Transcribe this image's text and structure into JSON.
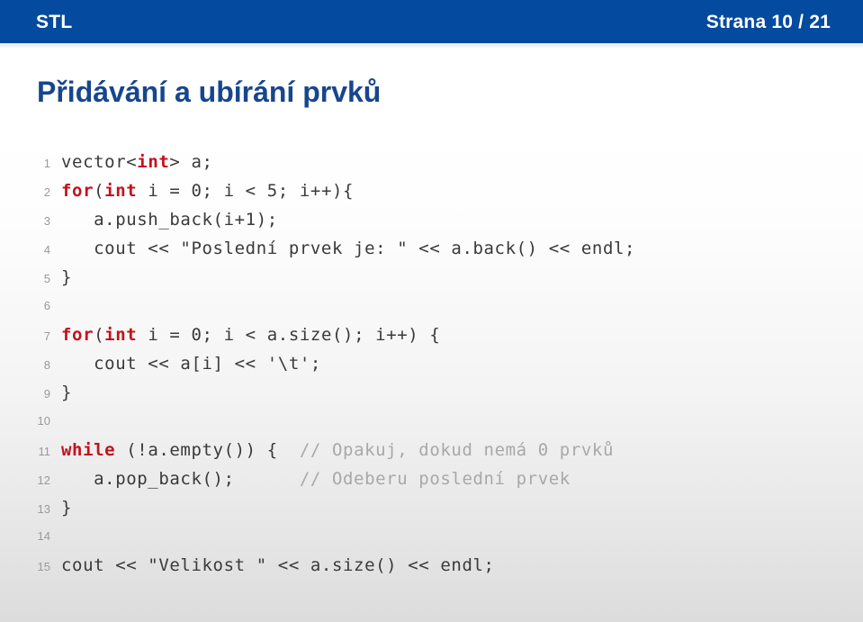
{
  "header": {
    "title": "STL",
    "page_label": "Strana 10 / 21",
    "bar_color": "#044a9e",
    "text_color": "#ffffff"
  },
  "slide": {
    "title": "Přidávání a ubírání prvků",
    "title_color": "#17468f"
  },
  "code": {
    "language": "C++",
    "keyword_color": "#c1121c",
    "comment_color": "#a8a8a8",
    "text_color": "#3a3a3a",
    "line_number_color": "#9a9a9a",
    "lines": [
      {
        "n": "1",
        "text": "vector<int> a;",
        "parts": [
          {
            "t": "vector<",
            "c": "pl"
          },
          {
            "t": "int",
            "c": "kw"
          },
          {
            "t": "> a;",
            "c": "pl"
          }
        ]
      },
      {
        "n": "2",
        "text": "for(int i = 0; i < 5; i++){",
        "parts": [
          {
            "t": "for",
            "c": "kw"
          },
          {
            "t": "(",
            "c": "pl"
          },
          {
            "t": "int",
            "c": "kw"
          },
          {
            "t": " i = 0; i < 5; i++){",
            "c": "pl"
          }
        ]
      },
      {
        "n": "3",
        "text": "   a.push_back(i+1);",
        "parts": [
          {
            "t": "   a.push_back(i+1);",
            "c": "pl"
          }
        ]
      },
      {
        "n": "4",
        "text": "   cout << \"Poslední prvek je: \" << a.back() << endl;",
        "parts": [
          {
            "t": "   cout << \"Poslední prvek je: \" << a.back() << endl;",
            "c": "pl"
          }
        ]
      },
      {
        "n": "5",
        "text": "}",
        "parts": [
          {
            "t": "}",
            "c": "pl"
          }
        ]
      },
      {
        "n": "6",
        "text": "",
        "parts": []
      },
      {
        "n": "7",
        "text": "for(int i = 0; i < a.size(); i++) {",
        "parts": [
          {
            "t": "for",
            "c": "kw"
          },
          {
            "t": "(",
            "c": "pl"
          },
          {
            "t": "int",
            "c": "kw"
          },
          {
            "t": " i = 0; i < a.size(); i++) {",
            "c": "pl"
          }
        ]
      },
      {
        "n": "8",
        "text": "   cout << a[i] << '\\t';",
        "parts": [
          {
            "t": "   cout << a[i] << '\\t';",
            "c": "pl"
          }
        ]
      },
      {
        "n": "9",
        "text": "}",
        "parts": [
          {
            "t": "}",
            "c": "pl"
          }
        ]
      },
      {
        "n": "10",
        "text": "",
        "parts": []
      },
      {
        "n": "11",
        "text": "while (!a.empty()) {  // Opakuj, dokud nemá 0 prvků",
        "parts": [
          {
            "t": "while",
            "c": "kw"
          },
          {
            "t": " (!a.empty()) {  ",
            "c": "pl"
          },
          {
            "t": "// Opakuj, dokud nemá 0 prvků",
            "c": "cm"
          }
        ]
      },
      {
        "n": "12",
        "text": "   a.pop_back();      // Odeberu poslední prvek",
        "parts": [
          {
            "t": "   a.pop_back();      ",
            "c": "pl"
          },
          {
            "t": "// Odeberu poslední prvek",
            "c": "cm"
          }
        ]
      },
      {
        "n": "13",
        "text": "}",
        "parts": [
          {
            "t": "}",
            "c": "pl"
          }
        ]
      },
      {
        "n": "14",
        "text": "",
        "parts": []
      },
      {
        "n": "15",
        "text": "cout << \"Velikost \" << a.size() << endl;",
        "parts": [
          {
            "t": "cout << \"Velikost \" << a.size() << endl;",
            "c": "pl"
          }
        ]
      }
    ]
  }
}
